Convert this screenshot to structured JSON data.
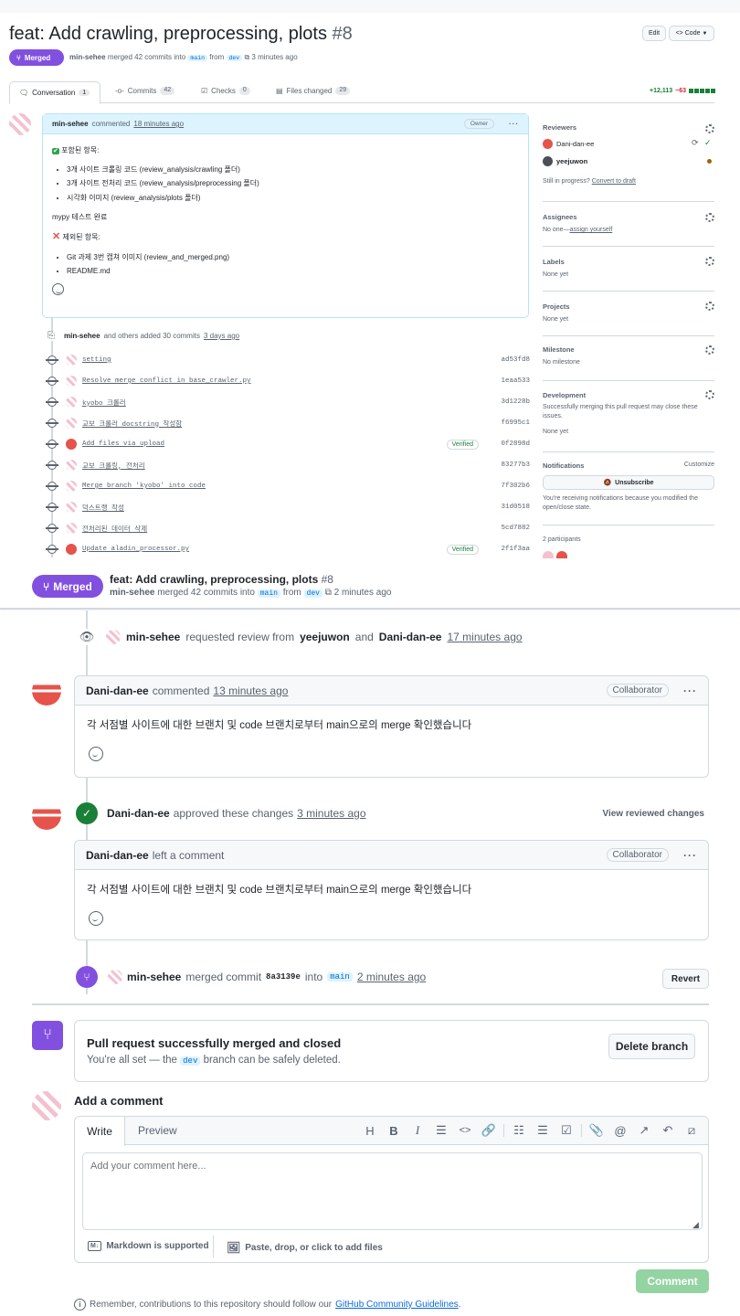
{
  "top": {
    "title": "feat: Add crawling, preprocessing, plots",
    "number": "#8",
    "state": "Merged",
    "author": "min-sehee",
    "merge_text": "merged 42 commits into",
    "base": "main",
    "from": "from",
    "head": "dev",
    "time": "3 minutes ago",
    "edit": "Edit",
    "code": "Code",
    "tabs": [
      {
        "label": "Conversation",
        "count": "1"
      },
      {
        "label": "Commits",
        "count": "42"
      },
      {
        "label": "Checks",
        "count": "0"
      },
      {
        "label": "Files changed",
        "count": "29"
      }
    ],
    "diff_add": "+12,113",
    "diff_del": "−63"
  },
  "comment": {
    "author": "min-sehee",
    "action": "commented",
    "time": "18 minutes ago",
    "role": "Owner",
    "included_title": "포함된 항목:",
    "included": [
      "3개 사이트 크롤링 코드 (review_analysis/crawling 폴더)",
      "3개 사이트 전처리 코드 (review_analysis/preprocessing 폴더)",
      "시각화 이미지 (review_analysis/plots 폴더)"
    ],
    "mypy": "mypy 테스트 완료",
    "excluded_title": "제외된 항목:",
    "excluded": [
      "Git 과제 3번 캡쳐 이미지 (review_and_merged.png)",
      "README.md"
    ]
  },
  "commits_header": {
    "author": "min-sehee",
    "text": "and others added 30 commits",
    "time": "3 days ago"
  },
  "commits": [
    {
      "msg": "setting",
      "sha": "ad53fd8",
      "verified": ""
    },
    {
      "msg": "Resolve merge conflict in base_crawler.py",
      "sha": "1eaa533",
      "verified": ""
    },
    {
      "msg": "kyobo 크롤러",
      "sha": "3d1228b",
      "verified": ""
    },
    {
      "msg": "교보 크롤러 docstring 작성함",
      "sha": "f6995c1",
      "verified": ""
    },
    {
      "msg": "Add files via upload",
      "sha": "0f2898d",
      "verified": "Verified"
    },
    {
      "msg": "교보 크롤링, 전처리",
      "sha": "83277b3",
      "verified": ""
    },
    {
      "msg": "Merge branch 'kyobo' into code",
      "sha": "7f302b6",
      "verified": ""
    },
    {
      "msg": "덕스트랭 작성",
      "sha": "31d0518",
      "verified": ""
    },
    {
      "msg": "전처리된 데이터 삭제",
      "sha": "5cd7882",
      "verified": ""
    },
    {
      "msg": "Update aladin_processor.py",
      "sha": "2f1f3aa",
      "verified": "Verified"
    }
  ],
  "sidebar": {
    "reviewers": "Reviewers",
    "reviewer1": "Dani-dan-ee",
    "reviewer2": "yeejuwon",
    "still": "Still in progress?",
    "convert": "Convert to draft",
    "assignees": "Assignees",
    "assignees_val": "No one—",
    "assign_self": "assign yourself",
    "labels": "Labels",
    "labels_val": "None yet",
    "projects": "Projects",
    "projects_val": "None yet",
    "milestone": "Milestone",
    "milestone_val": "No milestone",
    "development": "Development",
    "dev_text": "Successfully merging this pull request may close these issues.",
    "dev_val": "None yet",
    "notifications": "Notifications",
    "customize": "Customize",
    "unsubscribe": "Unsubscribe",
    "notif_text": "You're receiving notifications because you modified the open/close state.",
    "participants": "2 participants"
  },
  "sticky": {
    "state": "Merged",
    "title": "feat: Add crawling, preprocessing, plots",
    "number": "#8",
    "author": "min-sehee",
    "merge_text": "merged 42 commits into",
    "base": "main",
    "from": "from",
    "head": "dev",
    "time": "2 minutes ago"
  },
  "review_req": {
    "author": "min-sehee",
    "text": "requested review from",
    "r1": "yeejuwon",
    "and": "and",
    "r2": "Dani-dan-ee",
    "time": "17 minutes ago"
  },
  "comment2": {
    "author": "Dani-dan-ee",
    "action": "commented",
    "time": "13 minutes ago",
    "role": "Collaborator",
    "body": "각 서점별 사이트에 대한 브랜치 및 code 브랜치로부터 main으로의 merge 확인했습니다"
  },
  "approve": {
    "author": "Dani-dan-ee",
    "text": "approved these changes",
    "time": "3 minutes ago",
    "view": "View reviewed changes"
  },
  "comment3": {
    "author": "Dani-dan-ee",
    "action": "left a comment",
    "role": "Collaborator",
    "body": "각 서점별 사이트에 대한 브랜치 및 code 브랜치로부터 main으로의 merge 확인했습니다"
  },
  "merged_event": {
    "author": "min-sehee",
    "text": "merged commit",
    "sha": "8a3139e",
    "into": "into",
    "base": "main",
    "time": "2 minutes ago",
    "revert": "Revert"
  },
  "merge_box": {
    "title": "Pull request successfully merged and closed",
    "sub1": "You're all set — the",
    "branch": "dev",
    "sub2": "branch can be safely deleted.",
    "delete": "Delete branch"
  },
  "add_comment": {
    "title": "Add a comment",
    "write": "Write",
    "preview": "Preview",
    "placeholder": "Add your comment here...",
    "markdown": "Markdown is supported",
    "paste": "Paste, drop, or click to add files",
    "submit": "Comment",
    "remember": "Remember, contributions to this repository should follow our",
    "guidelines": "GitHub Community Guidelines",
    "period": "."
  },
  "colors": {
    "merged": "#8250df",
    "green": "#1a7f37",
    "blue_border": "#b6e3ff"
  }
}
